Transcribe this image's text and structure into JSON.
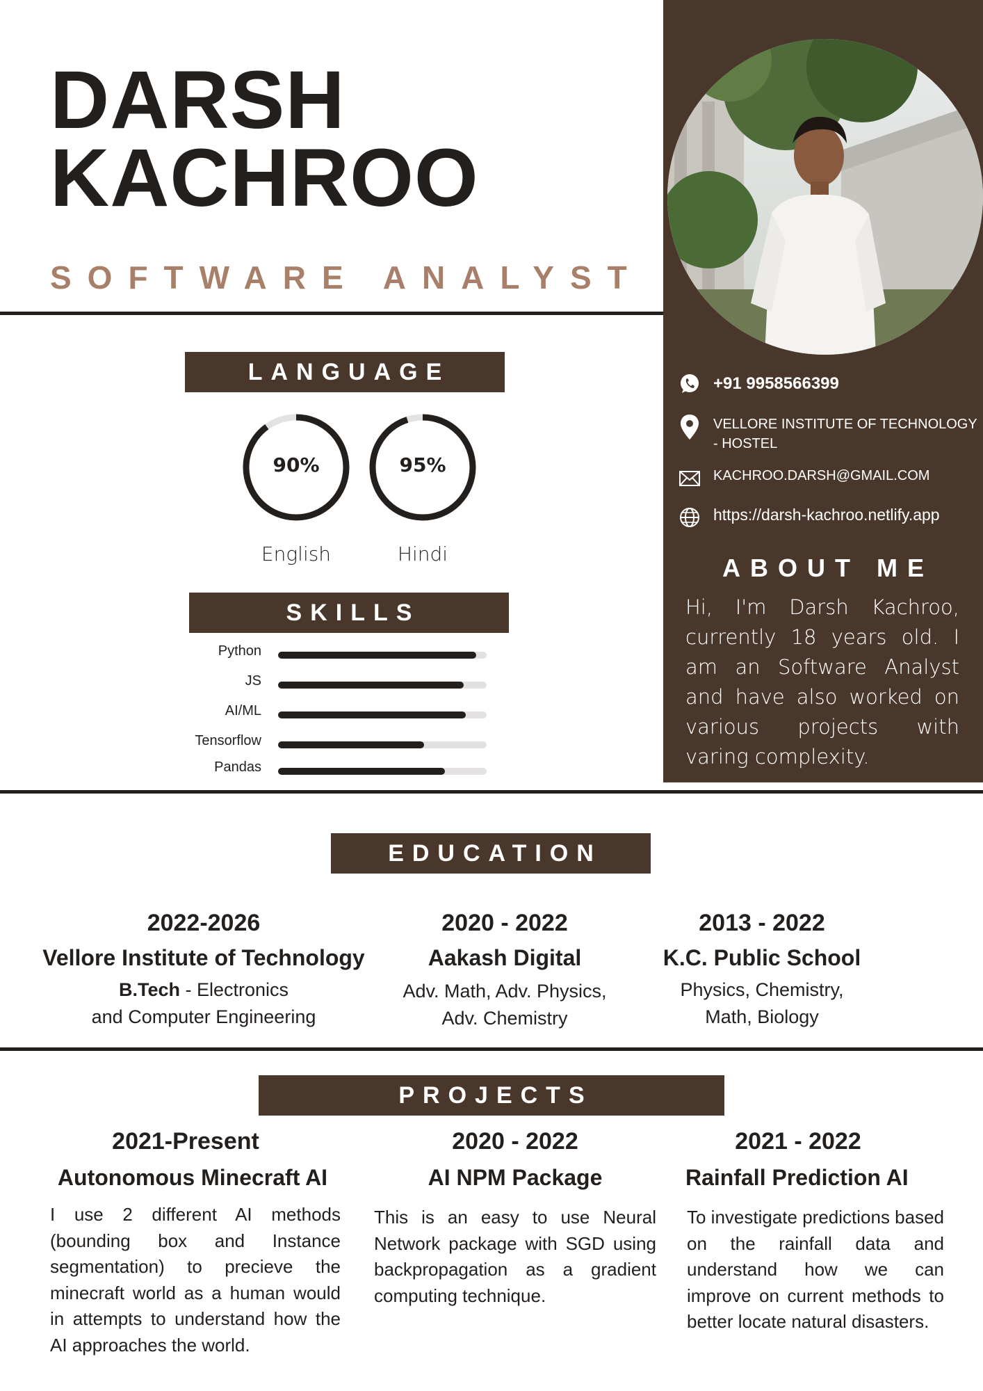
{
  "header": {
    "first_name": "DARSH",
    "last_name": "KACHROO",
    "role": "SOFTWARE ANALYST"
  },
  "contact": {
    "phone": "+91 9958566399",
    "address": "VELLORE INSTITUTE OF TECHNOLOGY - HOSTEL",
    "email": "KACHROO.DARSH@GMAIL.COM",
    "website": "https://darsh-kachroo.netlify.app"
  },
  "about": {
    "title": "ABOUT ME",
    "text": "Hi, I'm Darsh Kachroo, currently 18 years old. I am an Software Analyst and have also worked on various projects with varing complexity."
  },
  "language": {
    "title": "LANGUAGE",
    "items": [
      {
        "name": "English",
        "percent_label": "90%",
        "level": 0.9
      },
      {
        "name": "Hindi",
        "percent_label": "95%",
        "level": 0.95
      }
    ]
  },
  "skills": {
    "title": "SKILLS",
    "items": [
      {
        "name": "Python",
        "level": 0.95
      },
      {
        "name": "JS",
        "level": 0.89
      },
      {
        "name": "AI/ML",
        "level": 0.9
      },
      {
        "name": "Tensorflow",
        "level": 0.7
      },
      {
        "name": "Pandas",
        "level": 0.8
      }
    ]
  },
  "education": {
    "title": "EDUCATION",
    "items": [
      {
        "years": "2022-2026",
        "institution": "Vellore Institute of Technology",
        "degree_bold": "B.Tech",
        "detail_line1": " - Electronics",
        "detail_line2": "and Computer Engineering"
      },
      {
        "years": "2020 - 2022",
        "institution": "Aakash Digital",
        "degree_bold": "",
        "detail_line1": "Adv. Math, Adv. Physics,",
        "detail_line2": "Adv. Chemistry"
      },
      {
        "years": "2013 - 2022",
        "institution": "K.C. Public School",
        "degree_bold": "",
        "detail_line1": "Physics, Chemistry,",
        "detail_line2": "Math, Biology"
      }
    ]
  },
  "projects": {
    "title": "PROJECTS",
    "items": [
      {
        "years": "2021-Present",
        "name": "Autonomous Minecraft AI",
        "description": "I use 2 different AI methods (bounding box and Instance segmentation) to precieve the minecraft world as a human would in attempts to understand how the AI approaches the world."
      },
      {
        "years": "2020 - 2022",
        "name": "AI NPM Package",
        "description": "This is an easy to use Neural Network package with SGD using backpropagation as a gradient computing technique."
      },
      {
        "years": "2021 - 2022",
        "name": "Rainfall Prediction AI",
        "description": "To investigate predictions based on the rainfall data and understand how we can improve on current methods to better locate natural disasters."
      }
    ]
  },
  "colors": {
    "brown": "#4a372b",
    "dark": "#231f1d",
    "accent": "#a8806a",
    "track": "#e3e1e2"
  }
}
